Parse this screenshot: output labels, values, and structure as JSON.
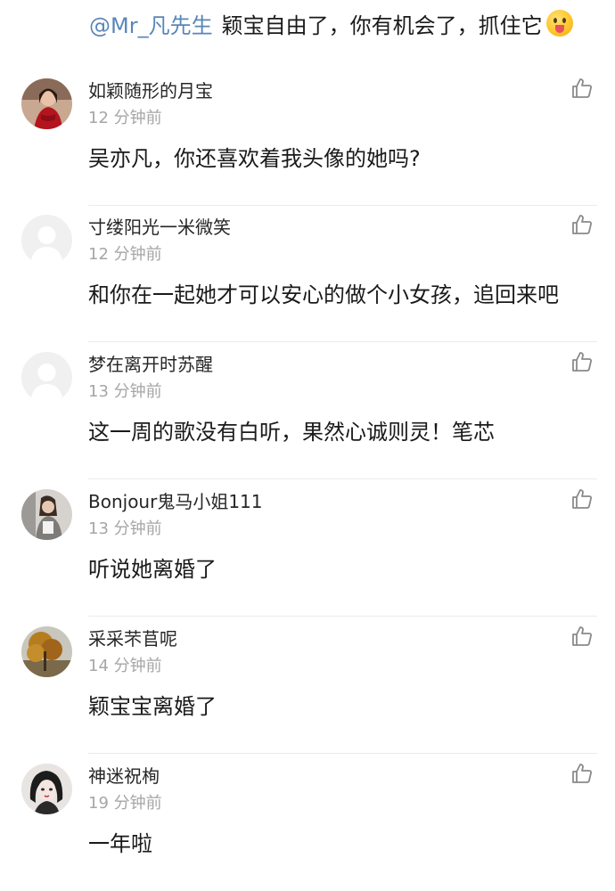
{
  "top_reply": {
    "mention": "@Mr_凡先生",
    "text": "颖宝自由了，你有机会了，抓住它",
    "emoji_icon": "tongue-out-emoji"
  },
  "comments": [
    {
      "username": "如颖随形的月宝",
      "time": "12 分钟前",
      "text": "吴亦凡，你还喜欢着我头像的她吗?",
      "avatar": "photo-woman-red-dress",
      "like_icon": "thumbs-up-icon"
    },
    {
      "username": "寸缕阳光一米微笑",
      "time": "12 分钟前",
      "text": "和你在一起她才可以安心的做个小女孩，追回来吧",
      "avatar": "default-avatar",
      "like_icon": "thumbs-up-icon"
    },
    {
      "username": "梦在离开时苏醒",
      "time": "13 分钟前",
      "text": "这一周的歌没有白听，果然心诚则灵！笔芯",
      "avatar": "default-avatar",
      "like_icon": "thumbs-up-icon"
    },
    {
      "username": "Bonjour鬼马小姐111",
      "time": "13 分钟前",
      "text": "听说她离婚了",
      "avatar": "photo-girl-grey-sweater",
      "like_icon": "thumbs-up-icon"
    },
    {
      "username": "采采芣苢呢",
      "time": "14 分钟前",
      "text": "颖宝宝离婚了",
      "avatar": "photo-autumn-tree",
      "like_icon": "thumbs-up-icon"
    },
    {
      "username": "神迷祝栒",
      "time": "19 分钟前",
      "text": "一年啦",
      "avatar": "illustration-anime-girl",
      "like_icon": "thumbs-up-icon"
    }
  ]
}
